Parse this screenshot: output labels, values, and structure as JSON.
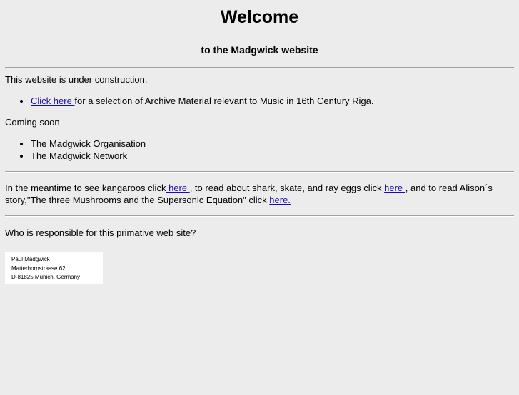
{
  "header": {
    "title": "Welcome",
    "subtitle": "to the Madgwick website"
  },
  "intro": {
    "construction": "This website is under construction.",
    "archive_link": "Click here ",
    "archive_text": "for a selection of Archive Material relevant to Music in 16th Century Riga."
  },
  "coming_soon": {
    "heading": "Coming soon",
    "items": [
      "The Madgwick Organisation",
      "The Madgwick Network"
    ]
  },
  "meantime": {
    "text1": "In the meantime to see kangaroos click",
    "link1": " here ",
    "text2": ", to read about shark, skate, and ray eggs click ",
    "link2": "here ",
    "text3": ", and to read Alison´s story,\"The three Mushrooms and the Supersonic Equation\" click ",
    "link3": "here."
  },
  "responsible": {
    "question": "Who is responsible for this primative web site?"
  },
  "address": {
    "name": "Paul Madgwick",
    "street": "Matterhornstrasse 62,",
    "city": "D-81825 Munich, Germany"
  }
}
